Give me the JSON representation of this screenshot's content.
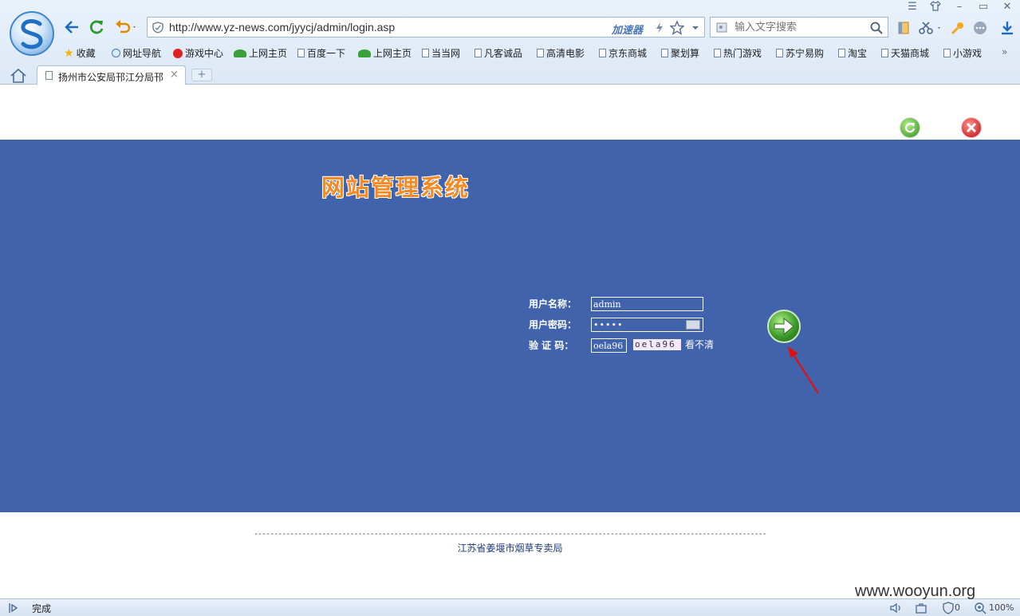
{
  "browser": {
    "url": "http://www.yz-news.com/jyycj/admin/login.asp",
    "accelerator_label": "加速器",
    "search_placeholder": "输入文字搜索",
    "bookmarks": [
      {
        "label": "收藏",
        "icon": "star-icon"
      },
      {
        "label": "网址导航",
        "icon": "globe-icon"
      },
      {
        "label": "游戏中心",
        "icon": "game-icon"
      },
      {
        "label": "上网主页",
        "icon": "hao-icon"
      },
      {
        "label": "百度一下",
        "icon": "page-icon"
      },
      {
        "label": "上网主页",
        "icon": "hao-icon"
      },
      {
        "label": "当当网",
        "icon": "page-icon"
      },
      {
        "label": "凡客诚品",
        "icon": "page-icon"
      },
      {
        "label": "高清电影",
        "icon": "page-icon"
      },
      {
        "label": "京东商城",
        "icon": "page-icon"
      },
      {
        "label": "聚划算",
        "icon": "page-icon"
      },
      {
        "label": "热门游戏",
        "icon": "page-icon"
      },
      {
        "label": "苏宁易购",
        "icon": "page-icon"
      },
      {
        "label": "淘宝",
        "icon": "page-icon"
      },
      {
        "label": "天猫商城",
        "icon": "page-icon"
      },
      {
        "label": "小游戏",
        "icon": "page-icon"
      }
    ],
    "more_bookmarks": "»",
    "tab_title": "扬州市公安局邗江分局邗",
    "tab_close": "×",
    "new_tab": "+"
  },
  "page": {
    "site_title": "网站管理系统",
    "form": {
      "username_label": "用户名称：",
      "username_value": "admin",
      "password_label": "用户密码：",
      "password_value": "•••••",
      "captcha_label": "验 证 码：",
      "captcha_input_value": "oela96",
      "captcha_image_text": "oela96",
      "captcha_refresh_label": "看不清"
    },
    "footer_divider": "-----------------------------------------------------------------------------------------------------------------------------------------------",
    "footer_text": "江苏省姜堰市烟草专卖局"
  },
  "status": {
    "text": "完成",
    "count": "0",
    "zoom": "100%"
  },
  "watermark": "www.wooyun.org",
  "colors": {
    "banner": "#4163ab",
    "title_orange": "#f58a24",
    "go_green": "#3c9a2a"
  }
}
